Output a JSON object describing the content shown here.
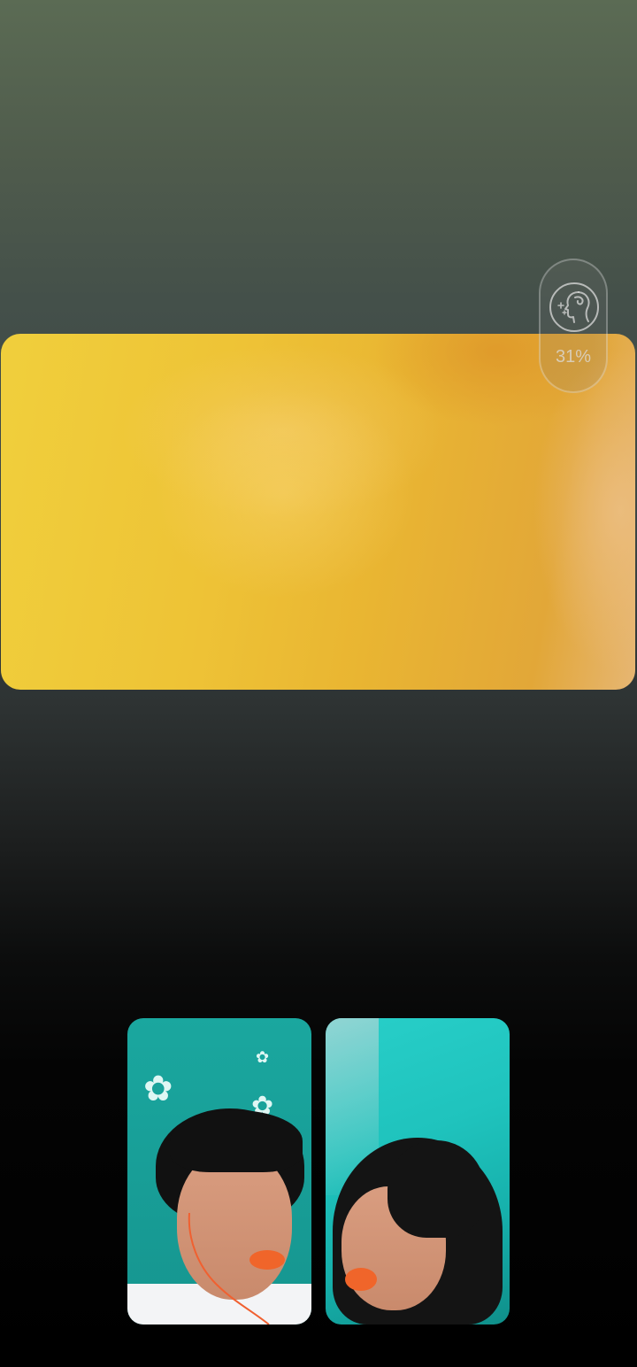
{
  "app": {
    "screen": "video-call"
  },
  "beauty_filter": {
    "icon": "face-beauty-icon",
    "value": "31%"
  },
  "main_video": {
    "label": "remote-video-feed"
  },
  "participants": [
    {
      "id": "participant-1"
    },
    {
      "id": "participant-2"
    }
  ],
  "colors": {
    "background_top": "#5b6b54",
    "background_bottom": "#000000",
    "main_video_tone": "#eec336",
    "thumbnail_teal": "#1aa79f"
  }
}
